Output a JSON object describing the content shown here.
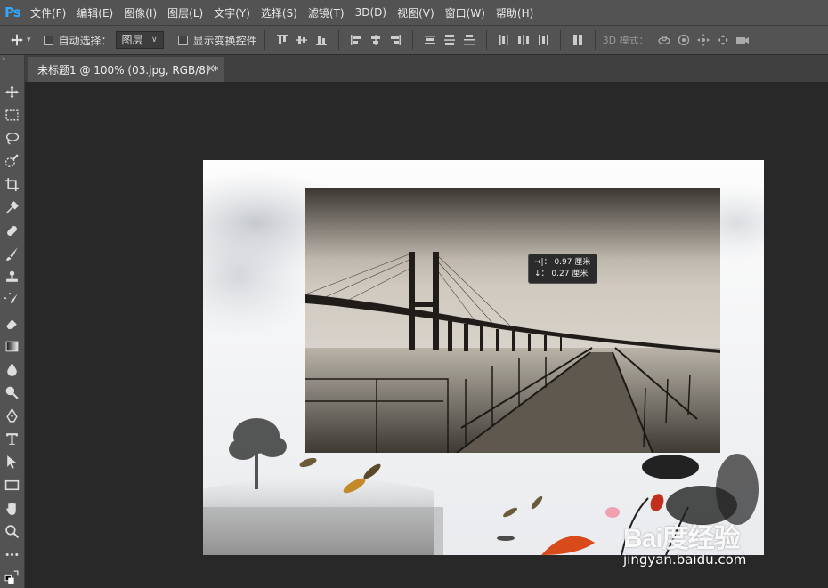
{
  "app": {
    "logo": "Ps"
  },
  "menu": [
    "文件(F)",
    "编辑(E)",
    "图像(I)",
    "图层(L)",
    "文字(Y)",
    "选择(S)",
    "滤镜(T)",
    "3D(D)",
    "视图(V)",
    "窗口(W)",
    "帮助(H)"
  ],
  "options": {
    "move_icon": "move-icon",
    "auto_select_label": "自动选择：",
    "auto_select_checked": false,
    "auto_select_target": "图层",
    "show_transform_label": "显示变换控件",
    "show_transform_checked": false,
    "mode_3d_label": "3D 模式："
  },
  "document": {
    "tab_title": "未标题1 @ 100% (03.jpg, RGB/8) *",
    "close_glyph": "×"
  },
  "measure": {
    "dx_icon": "→|：",
    "dx_value": "0.97",
    "dx_unit": "厘米",
    "dy_icon": "↓：",
    "dy_value": "0.27",
    "dy_unit": "厘米"
  },
  "watermark": {
    "brand": "Bai度经验",
    "url": "jingyan.baidu.com"
  },
  "tools": [
    "move-tool-icon",
    "marquee-tool-icon",
    "lasso-tool-icon",
    "quick-select-tool-icon",
    "crop-tool-icon",
    "eyedropper-tool-icon",
    "healing-brush-tool-icon",
    "brush-tool-icon",
    "clone-stamp-tool-icon",
    "history-brush-tool-icon",
    "eraser-tool-icon",
    "gradient-tool-icon",
    "blur-tool-icon",
    "dodge-tool-icon",
    "pen-tool-icon",
    "type-tool-icon",
    "path-select-tool-icon",
    "rectangle-tool-icon",
    "hand-tool-icon",
    "zoom-tool-icon",
    "more-tools-icon",
    "color-swap-icon"
  ],
  "colors": {
    "panel": "#535353",
    "workspace": "#282828",
    "accent": "#31a8ff"
  }
}
